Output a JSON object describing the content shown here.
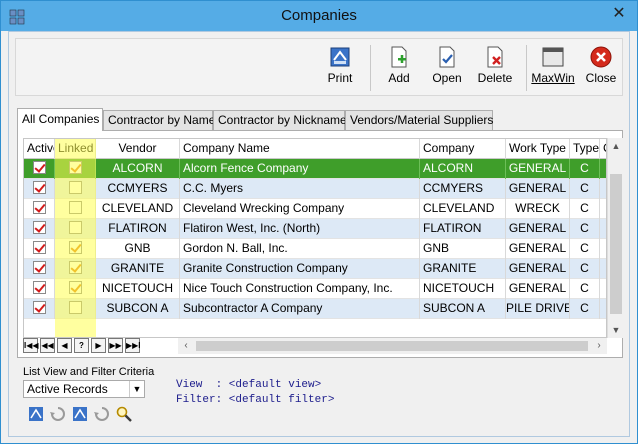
{
  "window": {
    "title": "Companies"
  },
  "toolbar": {
    "print": "Print",
    "add": "Add",
    "open": "Open",
    "delete": "Delete",
    "maxwin": "MaxWin",
    "close": "Close"
  },
  "tabs": [
    "All Companies",
    "Contractor by Name",
    "Contractor by Nickname",
    "Vendors/Material Suppliers"
  ],
  "grid": {
    "columns": [
      "Active",
      "Linked",
      "Vendor",
      "Company Name",
      "Company",
      "Work Type",
      "Type",
      "C"
    ],
    "rows": [
      {
        "active": true,
        "linked": true,
        "vendor": "ALCORN",
        "name": "Alcorn Fence Company",
        "company": "ALCORN",
        "work_type": "GENERAL",
        "type": "C"
      },
      {
        "active": true,
        "linked": false,
        "vendor": "CCMYERS",
        "name": "C.C. Myers",
        "company": "CCMYERS",
        "work_type": "GENERAL",
        "type": "C"
      },
      {
        "active": true,
        "linked": false,
        "vendor": "CLEVELAND",
        "name": "Cleveland Wrecking Company",
        "company": "CLEVELAND",
        "work_type": "WRECK",
        "type": "C"
      },
      {
        "active": true,
        "linked": false,
        "vendor": "FLATIRON",
        "name": "Flatiron West, Inc. (North)",
        "company": "FLATIRON",
        "work_type": "GENERAL",
        "type": "C"
      },
      {
        "active": true,
        "linked": true,
        "vendor": "GNB",
        "name": "Gordon N. Ball, Inc.",
        "company": "GNB",
        "work_type": "GENERAL",
        "type": "C"
      },
      {
        "active": true,
        "linked": true,
        "vendor": "GRANITE",
        "name": "Granite Construction Company",
        "company": "GRANITE",
        "work_type": "GENERAL",
        "type": "C"
      },
      {
        "active": true,
        "linked": true,
        "vendor": "NICETOUCH",
        "name": "Nice Touch Construction Company, Inc.",
        "company": "NICETOUCH",
        "work_type": "GENERAL",
        "type": "C"
      },
      {
        "active": true,
        "linked": false,
        "vendor": "SUBCON A",
        "name": "Subcontractor A Company",
        "company": "SUBCON A",
        "work_type": "PILE DRIVE",
        "type": "C"
      }
    ],
    "selected_row": 0
  },
  "navbar": {
    "first": "I◀◀",
    "prev_page": "◀◀",
    "prev": "◀",
    "help": "?",
    "next": "▶",
    "next_page": "▶▶",
    "last": "▶▶I"
  },
  "filter": {
    "title": "List View and Filter Criteria",
    "selected": "Active Records",
    "view_line": "View  : <default view>",
    "filter_line": "Filter: <default filter>"
  },
  "colors": {
    "selected_row": "#3f9e2a",
    "alt_row": "#dde9f6",
    "linked_highlight": "#ffff50",
    "title_bar": "#55ace6"
  }
}
